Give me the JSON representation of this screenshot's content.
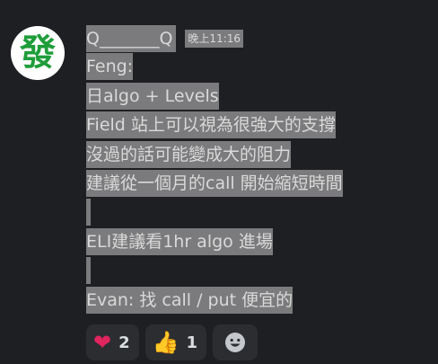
{
  "author": {
    "avatar_glyph": "發",
    "username": "Q_______Q",
    "timestamp": "晚上11:16"
  },
  "message_lines": [
    "Feng:",
    "日algo + Levels",
    "Field 站上可以視為很強大的支撐",
    "沒過的話可能變成大的阻力",
    "建議從一個月的call 開始縮短時間",
    "",
    "ELI建議看1hr algo 進場",
    "",
    "Evan: 找 call / put 便宜的"
  ],
  "reactions": [
    {
      "icon": "heart-icon",
      "emoji": "❤",
      "count": "2"
    },
    {
      "icon": "thumbs-up-icon",
      "emoji": "👍",
      "count": "1"
    }
  ],
  "add_reaction_icon": "smiley-icon",
  "colors": {
    "background": "#1e1f22",
    "highlight": "#7b7b7d",
    "reaction_bg": "#2b2d31",
    "avatar_green": "#1f9d3a"
  }
}
